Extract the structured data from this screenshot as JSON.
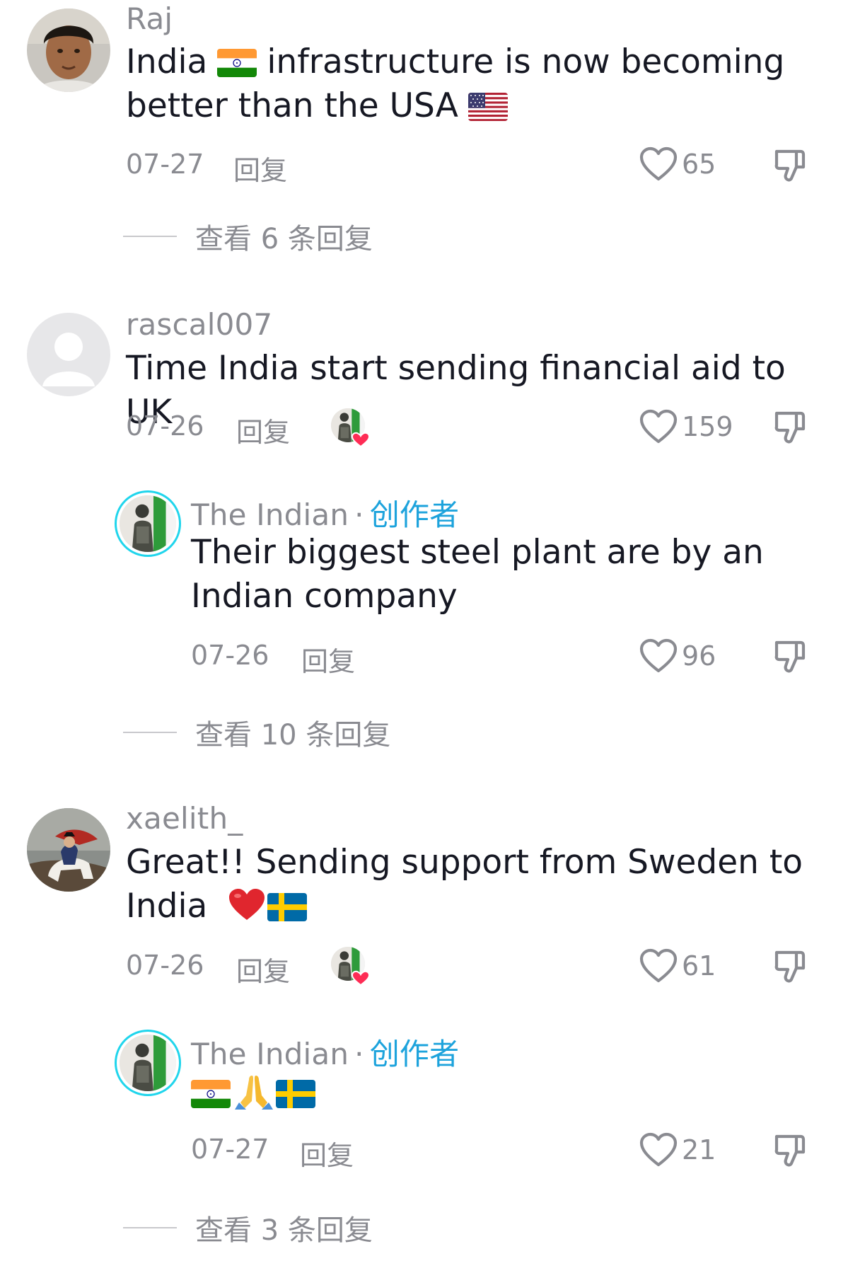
{
  "comments": [
    {
      "username": "Raj",
      "text_parts": [
        "India",
        "infrastructure is now becoming better than the USA"
      ],
      "date": "07-27",
      "reply_label": "回复",
      "likes": "65",
      "view_replies": "查看 6 条回复"
    },
    {
      "username": "rascal007",
      "text": "Time India start sending financial aid to UK",
      "date": "07-26",
      "reply_label": "回复",
      "likes": "159",
      "reply": {
        "username": "The Indian",
        "creator_tag": "创作者",
        "text_line1": "Their biggest steel plant are by an",
        "text_line2": "Indian company",
        "date": "07-26",
        "reply_label": "回复",
        "likes": "96"
      },
      "view_replies": "查看 10 条回复"
    },
    {
      "username": "xaelith_",
      "text_line1": "Great!! Sending support from Sweden to",
      "text_line2": "India",
      "date": "07-26",
      "reply_label": "回复",
      "likes": "61",
      "reply": {
        "username": "The Indian",
        "creator_tag": "创作者",
        "date": "07-27",
        "reply_label": "回复",
        "likes": "21"
      },
      "view_replies": "查看 3 条回复"
    }
  ],
  "icons": {
    "like": "heart-outline-icon",
    "dislike": "thumbs-down-icon",
    "liked_by_creator": "creator-liked-icon"
  },
  "colors": {
    "text": "#161823",
    "muted": "#8a8b91",
    "creator_tag": "#1da3dc",
    "creator_ring": "#20d5ec",
    "heart_red": "#fe2c55"
  }
}
